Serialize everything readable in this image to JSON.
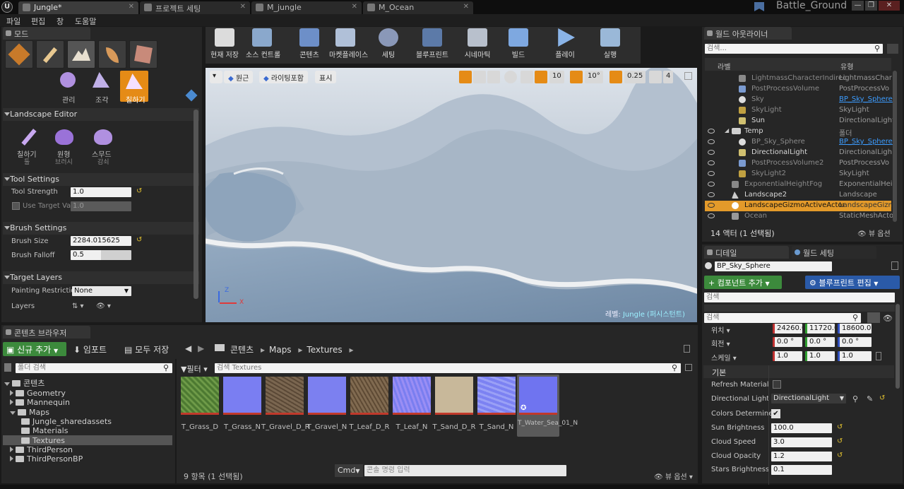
{
  "window": {
    "tabs": [
      "Jungle*",
      "프로젝트 세팅",
      "M_jungle",
      "M_Ocean"
    ],
    "project": "Battle_Ground"
  },
  "menu": [
    "파일",
    "편집",
    "창",
    "도움말"
  ],
  "modes": {
    "tab": "모드",
    "subtools": [
      "관리",
      "조각",
      "칠하기"
    ],
    "editor_title": "Landscape Editor",
    "paint_tools": [
      {
        "label": "칠하기",
        "sub": "툴"
      },
      {
        "label": "원형",
        "sub": "브러시"
      },
      {
        "label": "스무드",
        "sub": "감쇠"
      }
    ],
    "tool_settings": {
      "title": "Tool Settings",
      "tool_strength_label": "Tool Strength",
      "tool_strength": "1.0",
      "use_target_label": "Use Target Val",
      "use_target_value": "1.0"
    },
    "brush_settings": {
      "title": "Brush Settings",
      "size_label": "Brush Size",
      "size": "2284.015625",
      "falloff_label": "Brush Falloff",
      "falloff": "0.5"
    },
    "target_layers": {
      "title": "Target Layers",
      "restriction_label": "Painting Restrictio",
      "restriction": "None",
      "layers_label": "Layers"
    }
  },
  "toolbar": [
    "현재 저장",
    "소스 컨트롤",
    "콘텐츠",
    "마켓플레이스",
    "세팅",
    "블루프린트",
    "시네마틱",
    "빌드",
    "플레이",
    "실행"
  ],
  "viewport": {
    "buttons": [
      "원근",
      "라이팅포함",
      "표시"
    ],
    "grid": "10",
    "angle": "10°",
    "scale": "0.25",
    "cam_speed": "4",
    "level_label": "레벨:",
    "level_name": "Jungle (퍼시스턴트)"
  },
  "outliner": {
    "tab": "월드 아웃라이너",
    "search": "검색...",
    "col_label": "라벨",
    "col_type": "유형",
    "rows": [
      {
        "name": "LightmassCharacterIndirec",
        "type": "LightmassChar"
      },
      {
        "name": "PostProcessVolume",
        "type": "PostProcessVo"
      },
      {
        "name": "Sky",
        "type": "BP_Sky_Sphere"
      },
      {
        "name": "SkyLight",
        "type": "SkyLight"
      },
      {
        "name": "Sun",
        "type": "DirectionalLight"
      },
      {
        "name": "Temp",
        "type": "폴더"
      },
      {
        "name": "BP_Sky_Sphere",
        "type": "BP_Sky_Sphere"
      },
      {
        "name": "DirectionalLight",
        "type": "DirectionalLigh"
      },
      {
        "name": "PostProcessVolume2",
        "type": "PostProcessVo"
      },
      {
        "name": "SkyLight2",
        "type": "SkyLight"
      },
      {
        "name": "ExponentialHeightFog",
        "type": "ExponentialHei"
      },
      {
        "name": "Landscape2",
        "type": "Landscape"
      },
      {
        "name": "LandscapeGizmoActiveActor",
        "type": "LandscapeGizm"
      },
      {
        "name": "Ocean",
        "type": "StaticMeshActo"
      }
    ],
    "count": "14 액터 (1 선택됨)",
    "view_options": "뷰 옵션"
  },
  "details": {
    "tab": "디테일",
    "world_tab": "월드 세팅",
    "actor_name": "BP_Sky_Sphere",
    "add_component": "+ 컴포넌트 추가",
    "edit_bp": "블루프린트 편집",
    "search": "검색",
    "search2": "검색",
    "transform": {
      "location_label": "위치",
      "location": [
        "24260.0",
        "11720.0",
        "18600.0"
      ],
      "rotation_label": "회전",
      "rotation": [
        "0.0 °",
        "0.0 °",
        "0.0 °"
      ],
      "scale_label": "스케일",
      "scale": [
        "1.0",
        "1.0",
        "1.0"
      ]
    },
    "section": "기본",
    "props": [
      {
        "label": "Refresh Material",
        "value": ""
      },
      {
        "label": "Directional Light A",
        "value": "DirectionalLight"
      },
      {
        "label": "Colors Determined",
        "value": "✔"
      },
      {
        "label": "Sun Brightness",
        "value": "100.0"
      },
      {
        "label": "Cloud Speed",
        "value": "3.0"
      },
      {
        "label": "Cloud Opacity",
        "value": "1.2"
      },
      {
        "label": "Stars Brightness",
        "value": "0.1"
      }
    ]
  },
  "content_browser": {
    "tab": "콘텐츠 브라우저",
    "add_new": "신규 추가",
    "import": "임포트",
    "save_all": "모두 저장",
    "path": [
      "콘텐츠",
      "Maps",
      "Textures"
    ],
    "folder_search": "폴더 검색",
    "filter": "필터",
    "search": "검색 Textures",
    "tree": [
      "콘텐츠",
      "Geometry",
      "Mannequin",
      "Maps",
      "Jungle_sharedassets",
      "Materials",
      "Textures",
      "ThirdPerson",
      "ThirdPersonBP"
    ],
    "assets": [
      "T_Grass_D",
      "T_Grass_N",
      "T_Gravel_D_R",
      "T_Gravel_N",
      "T_Leaf_D_R",
      "T_Leaf_N",
      "T_Sand_D_R",
      "T_Sand_N",
      "T_Water_Sea_01_N"
    ],
    "status": "9 항목 (1 선택됨)",
    "cmd": "Cmd",
    "cmd_placeholder": "콘솔 명령 입력",
    "view_options": "뷰 옵션"
  }
}
